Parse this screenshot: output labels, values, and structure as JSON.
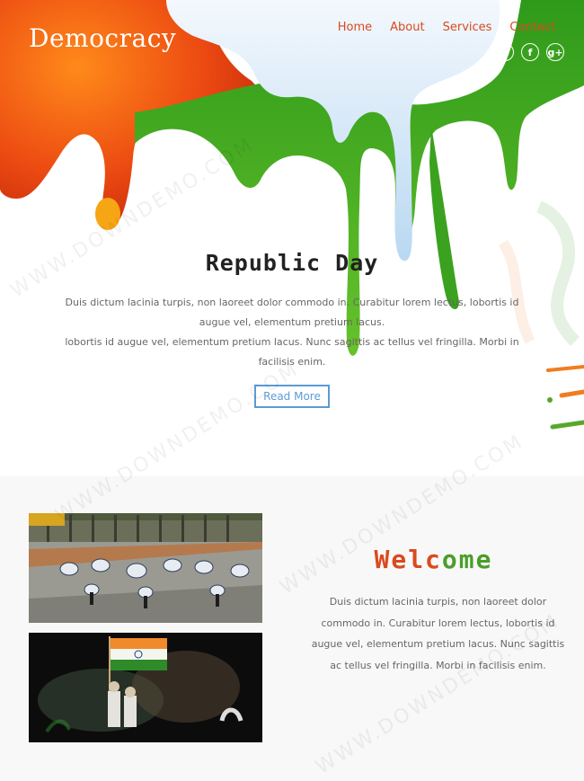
{
  "header": {
    "logo": "Democracy",
    "nav": [
      "Home",
      "About",
      "Services",
      "Contact"
    ],
    "social_icons": [
      "dribbble-icon",
      "facebook-icon",
      "google-plus-icon"
    ]
  },
  "hero": {
    "title": "Republic Day",
    "text1": "Duis dictum lacinia turpis, non laoreet dolor commodo in. Curabitur lorem lectus, lobortis id augue vel, elementum pretium lacus.",
    "text2": "lobortis id augue vel, elementum pretium lacus. Nunc sagittis ac tellus vel fringilla. Morbi in facilisis enim.",
    "button": "Read More"
  },
  "welcome": {
    "title_part1": "Welc",
    "title_part2": "ome",
    "text": "Duis dictum lacinia turpis, non laoreet dolor commodo in. Curabitur lorem lectus, lobortis id augue vel, elementum pretium lacus. Nunc sagittis ac tellus vel fringilla. Morbi in facilisis enim."
  },
  "watermark": "WWW.DOWNDEMO.COM",
  "colors": {
    "accent_red": "#d94a1e",
    "accent_green": "#4a9e2a",
    "button_blue": "#5b9bd5"
  }
}
